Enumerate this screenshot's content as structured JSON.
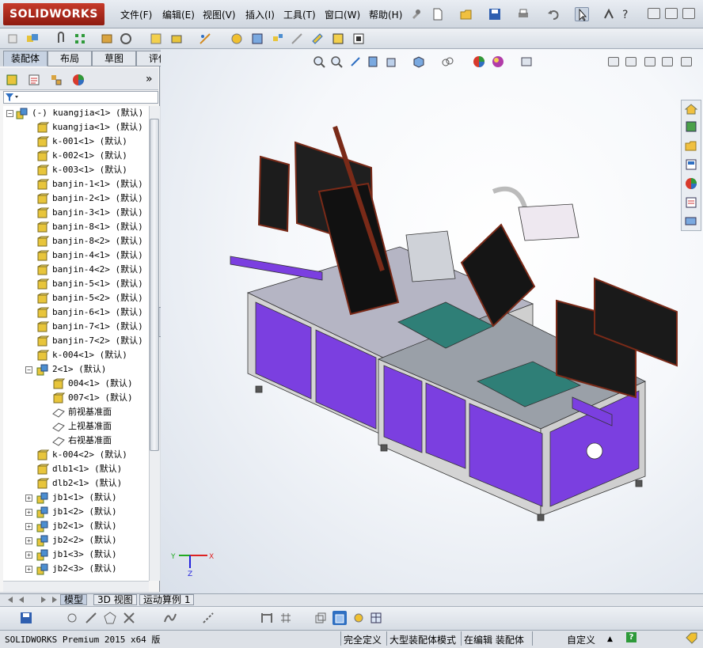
{
  "app": {
    "logo_text": "SOLIDWORKS"
  },
  "menu": [
    "文件(F)",
    "编辑(E)",
    "视图(V)",
    "插入(I)",
    "工具(T)",
    "窗口(W)",
    "帮助(H)"
  ],
  "command_tabs": [
    "装配体",
    "布局",
    "草图",
    "评估"
  ],
  "panel_more": "»",
  "tree": {
    "items": [
      {
        "label": "(-) kuangjia<1> (默认)",
        "indent": 0,
        "expander": "−",
        "icon": "assembly-icon"
      },
      {
        "label": "kuangjia<1> (默认)",
        "indent": 1,
        "expander": "",
        "icon": "part-icon"
      },
      {
        "label": "k-001<1> (默认)",
        "indent": 1,
        "expander": "",
        "icon": "part-icon"
      },
      {
        "label": "k-002<1> (默认)",
        "indent": 1,
        "expander": "",
        "icon": "part-icon"
      },
      {
        "label": "k-003<1> (默认)",
        "indent": 1,
        "expander": "",
        "icon": "part-icon"
      },
      {
        "label": "banjin-1<1> (默认)",
        "indent": 1,
        "expander": "",
        "icon": "part-icon"
      },
      {
        "label": "banjin-2<1> (默认)",
        "indent": 1,
        "expander": "",
        "icon": "part-icon"
      },
      {
        "label": "banjin-3<1> (默认)",
        "indent": 1,
        "expander": "",
        "icon": "part-icon"
      },
      {
        "label": "banjin-8<1> (默认)",
        "indent": 1,
        "expander": "",
        "icon": "part-icon"
      },
      {
        "label": "banjin-8<2> (默认)",
        "indent": 1,
        "expander": "",
        "icon": "part-icon"
      },
      {
        "label": "banjin-4<1> (默认)",
        "indent": 1,
        "expander": "",
        "icon": "part-icon"
      },
      {
        "label": "banjin-4<2> (默认)",
        "indent": 1,
        "expander": "",
        "icon": "part-icon"
      },
      {
        "label": "banjin-5<1> (默认)",
        "indent": 1,
        "expander": "",
        "icon": "part-icon"
      },
      {
        "label": "banjin-5<2> (默认)",
        "indent": 1,
        "expander": "",
        "icon": "part-icon"
      },
      {
        "label": "banjin-6<1> (默认)",
        "indent": 1,
        "expander": "",
        "icon": "part-icon"
      },
      {
        "label": "banjin-7<1> (默认)",
        "indent": 1,
        "expander": "",
        "icon": "part-icon"
      },
      {
        "label": "banjin-7<2> (默认)",
        "indent": 1,
        "expander": "",
        "icon": "part-icon"
      },
      {
        "label": "k-004<1> (默认)",
        "indent": 1,
        "expander": "",
        "icon": "part-icon"
      },
      {
        "label": "2<1> (默认)",
        "indent": 1,
        "expander": "−",
        "icon": "assembly-icon"
      },
      {
        "label": "004<1> (默认)",
        "indent": 2,
        "expander": "",
        "icon": "part-icon"
      },
      {
        "label": "007<1> (默认)",
        "indent": 2,
        "expander": "",
        "icon": "part-icon"
      },
      {
        "label": "前视基准面",
        "indent": 2,
        "expander": "",
        "icon": "plane-icon"
      },
      {
        "label": "上视基准面",
        "indent": 2,
        "expander": "",
        "icon": "plane-icon"
      },
      {
        "label": "右视基准面",
        "indent": 2,
        "expander": "",
        "icon": "plane-icon"
      },
      {
        "label": "k-004<2> (默认)",
        "indent": 1,
        "expander": "",
        "icon": "part-icon"
      },
      {
        "label": "dlb1<1> (默认)",
        "indent": 1,
        "expander": "",
        "icon": "part-icon"
      },
      {
        "label": "dlb2<1> (默认)",
        "indent": 1,
        "expander": "",
        "icon": "part-icon"
      },
      {
        "label": "jb1<1> (默认)",
        "indent": 1,
        "expander": "+",
        "icon": "assembly-icon"
      },
      {
        "label": "jb1<2> (默认)",
        "indent": 1,
        "expander": "+",
        "icon": "assembly-icon"
      },
      {
        "label": "jb2<1> (默认)",
        "indent": 1,
        "expander": "+",
        "icon": "assembly-icon"
      },
      {
        "label": "jb2<2> (默认)",
        "indent": 1,
        "expander": "+",
        "icon": "assembly-icon"
      },
      {
        "label": "jb1<3> (默认)",
        "indent": 1,
        "expander": "+",
        "icon": "assembly-icon"
      },
      {
        "label": "jb2<3> (默认)",
        "indent": 1,
        "expander": "+",
        "icon": "assembly-icon"
      }
    ]
  },
  "triad": {
    "x": "X",
    "y": "Y",
    "z": "Z"
  },
  "bottom_tabs": [
    "模型",
    "3D 视图",
    "运动算例 1"
  ],
  "status": {
    "product": "SOLIDWORKS Premium 2015 x64 版",
    "defined": "完全定义",
    "mode": "大型装配体模式",
    "editing": "在编辑 装配体",
    "units": "自定义",
    "units_arrow": "▲",
    "help": "?"
  },
  "colors": {
    "cabinet_purple": "#7b3fe0",
    "frame_grey": "#c8c8c8",
    "accent_teal": "#2f7f77",
    "brand_red": "#b02818"
  }
}
